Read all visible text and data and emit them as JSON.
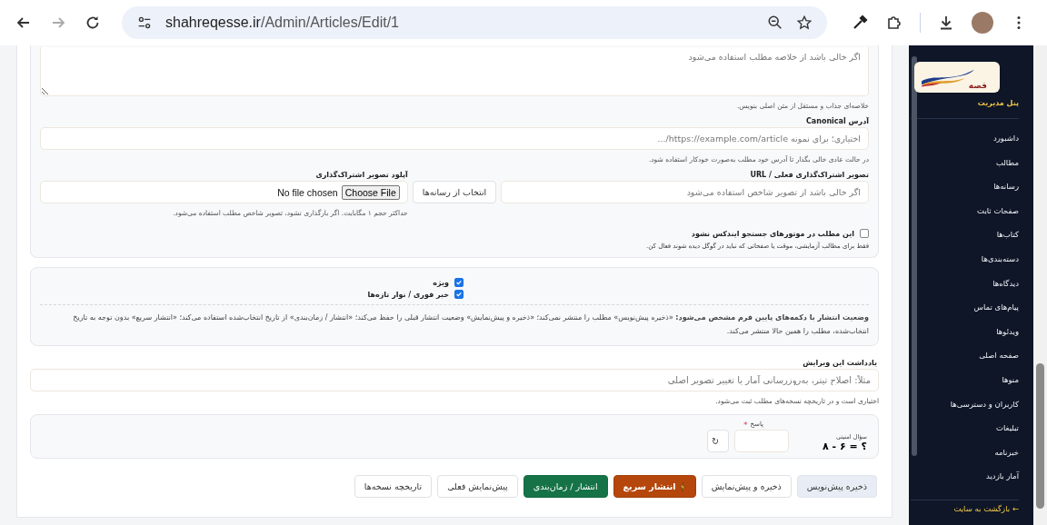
{
  "browser": {
    "url_host": "shahreqesse.ir",
    "url_path": "/Admin/Articles/Edit/1",
    "forward_disabled": true
  },
  "summary": {
    "placeholder": "اگر خالی باشد از خلاصه مطلب استفاده می‌شود",
    "hint": "خلاصه‌ای جذاب و مستقل از متن اصلی بنویس."
  },
  "canonical": {
    "label": "آدرس Canonical",
    "placeholder": "اختیاری؛ برای نمونه https://example.com/article/...",
    "hint": "در حالت عادی خالی بگذار تا آدرس خود مطلب به‌صورت خودکار استفاده شود."
  },
  "share_image": {
    "label": "تصویر اشتراک‌گذاری فعلی / URL",
    "placeholder": "اگر خالی باشد از تصویر شاخص استفاده می‌شود",
    "media_button": "انتخاب از رسانه‌ها"
  },
  "upload": {
    "label": "آپلود تصویر اشتراک‌گذاری",
    "file_button": "Choose File",
    "file_status": "No file chosen",
    "hint": "حداکثر حجم ۱ مگابایت. اگر بارگذاری نشود، تصویر شاخص مطلب استفاده می‌شود."
  },
  "noindex": {
    "label": "این مطلب در موتورهای جستجو ایندکس نشود",
    "checked": false,
    "hint": "فقط برای مطالب آزمایشی، موقت یا صفحاتی که نباید در گوگل دیده شوند فعال کن."
  },
  "flags": [
    {
      "label": "ویژه",
      "checked": true
    },
    {
      "label": "خبر فوری / نوار تازه‌ها",
      "checked": true
    }
  ],
  "publish_note": "**وضعیت انتشار با دکمه‌های پایین فرم مشخص می‌شود:** «ذخیره پیش‌نویس» مطلب را منتشر نمی‌کند؛ «ذخیره و پیش‌نمایش» وضعیت انتشار قبلی را حفظ می‌کند؛ «انتشار / زمان‌بندی» از تاریخ انتخاب‌شده استفاده می‌کند؛ «انتشار سریع» بدون توجه به تاریخ انتخاب‌شده، مطلب را همین حالا منتشر می‌کند.",
  "edit_note": {
    "label": "یادداشت این ویرایش",
    "placeholder": "مثلاً: اصلاح تیتر، به‌روزرسانی آمار یا تغییر تصویر اصلی",
    "hint": "اختیاری است و در تاریخچه نسخه‌های مطلب ثبت می‌شود."
  },
  "captcha": {
    "question_label": "سؤال امنیتی",
    "question": "۸ - ۶ = ؟",
    "answer_label": "پاسخ",
    "required_mark": "*",
    "refresh": "↻"
  },
  "buttons": [
    {
      "label": "ذخیره پیش‌نویس",
      "kind": "draft"
    },
    {
      "label": "ذخیره و پیش‌نمایش",
      "kind": "outline"
    },
    {
      "label": "انتشار سریع",
      "kind": "quick"
    },
    {
      "label": "انتشار / زمان‌بندی",
      "kind": "publish"
    },
    {
      "label": "پیش‌نمایش فعلی",
      "kind": "outline"
    },
    {
      "label": "تاریخچه نسخه‌ها",
      "kind": "outline"
    }
  ],
  "sidebar": {
    "logo_text": "قصه",
    "title": "پنل مدیریت",
    "items": [
      {
        "label": "داشبورد"
      },
      {
        "label": "مطالب"
      },
      {
        "label": "رسانه‌ها"
      },
      {
        "label": "صفحات ثابت"
      },
      {
        "label": "کتاب‌ها"
      },
      {
        "label": "دسته‌بندی‌ها"
      },
      {
        "label": "دیدگاه‌ها"
      },
      {
        "label": "پیام‌های تماس"
      },
      {
        "label": "ویدئوها"
      },
      {
        "label": "صفحه اصلی"
      },
      {
        "label": "منوها"
      },
      {
        "label": "کاربران و دسترسی‌ها"
      },
      {
        "label": "تبلیغات"
      },
      {
        "label": "خبرنامه"
      },
      {
        "label": "آمار بازدید"
      }
    ],
    "back_link": "← بازگشت به سایت"
  }
}
